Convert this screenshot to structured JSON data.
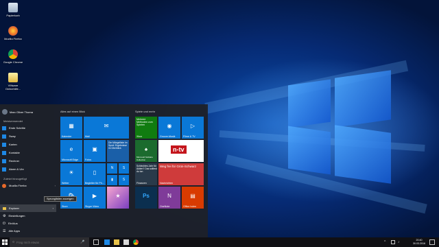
{
  "desktop": {
    "icons": [
      {
        "label": "Papierkorb",
        "icon": "recycle-bin-icon",
        "color": "#bcd"
      },
      {
        "label": "Mozilla Firefox",
        "icon": "firefox-icon",
        "color": "#e8692a"
      },
      {
        "label": "Google Chrome",
        "icon": "chrome-icon",
        "color": "#f2c230"
      },
      {
        "label": "VMware Onlinehilfe...",
        "icon": "vmware-help-icon",
        "color": "#f0d060"
      }
    ]
  },
  "start_menu": {
    "user": {
      "name": "Marc Oliver Thoma"
    },
    "most_used_label": "Meistverwendet",
    "most_used": [
      {
        "label": "Erste Schritte",
        "icon": "lightbulb-icon",
        "color": "#1e88e5"
      },
      {
        "label": "Sway",
        "icon": "sway-icon",
        "color": "#1e88e5"
      },
      {
        "label": "Karten",
        "icon": "maps-icon",
        "color": "#1e88e5"
      },
      {
        "label": "Kontakte",
        "icon": "people-icon",
        "color": "#1e88e5"
      },
      {
        "label": "Rechner",
        "icon": "calculator-icon",
        "color": "#1e88e5"
      },
      {
        "label": "Alarm & Uhr",
        "icon": "alarm-icon",
        "color": "#1e88e5"
      }
    ],
    "recent_label": "Zuletzt hinzugefügt",
    "recent": [
      {
        "label": "Mozilla Firefox",
        "icon": "firefox-icon",
        "color": "#e8692a"
      }
    ],
    "bottom": {
      "explorer": "Explorer",
      "settings": "Einstellungen",
      "power": "Ein/Aus",
      "all_apps": "Alle Apps"
    },
    "tooltip": "Sprunglisten anzeigen",
    "group1_title": "Alles auf einen Blick",
    "group2_title": "Spiele und mehr",
    "tiles": {
      "kalender": "Kalender",
      "mail": "Mail",
      "edge": "Microsoft Edge",
      "fotos": "Fotos",
      "cortana_text": "Die Mängelliste im Sport: Ergebnisse im Überblick",
      "wetter": "Wetter",
      "begleiter": "Begleiter für Ph...",
      "onenote_small": "OneNote",
      "store": "Store",
      "skype": "Skype Video",
      "candy": "",
      "ps": "Ps",
      "xbox_text": "Mehrere Methoden zum Spielen",
      "xbox": "Xbox",
      "groove": "Groove-Musik",
      "filme": "Filme & TV",
      "solitaire": "Microsoft Solitaire Collection",
      "ntv": "n-tv",
      "finanzen_text": "Schlechtes Jahr für Aktien? Das solltest du tun",
      "finanzen": "Finanzen",
      "news_text": "Weg frei für Grün-Schwarz",
      "nachrichten": "Nachrichten",
      "onenote": "OneNote",
      "office": "Office holen"
    }
  },
  "taskbar": {
    "search_placeholder": "Frag mich etwas",
    "time": "20:40",
    "date": "30.03.2016"
  },
  "colors": {
    "accent": "#0a78d7",
    "news_red": "#cf3b3b",
    "xbox_green": "#107c10",
    "onenote_purple": "#7f3b99",
    "office_orange": "#d83b01"
  }
}
